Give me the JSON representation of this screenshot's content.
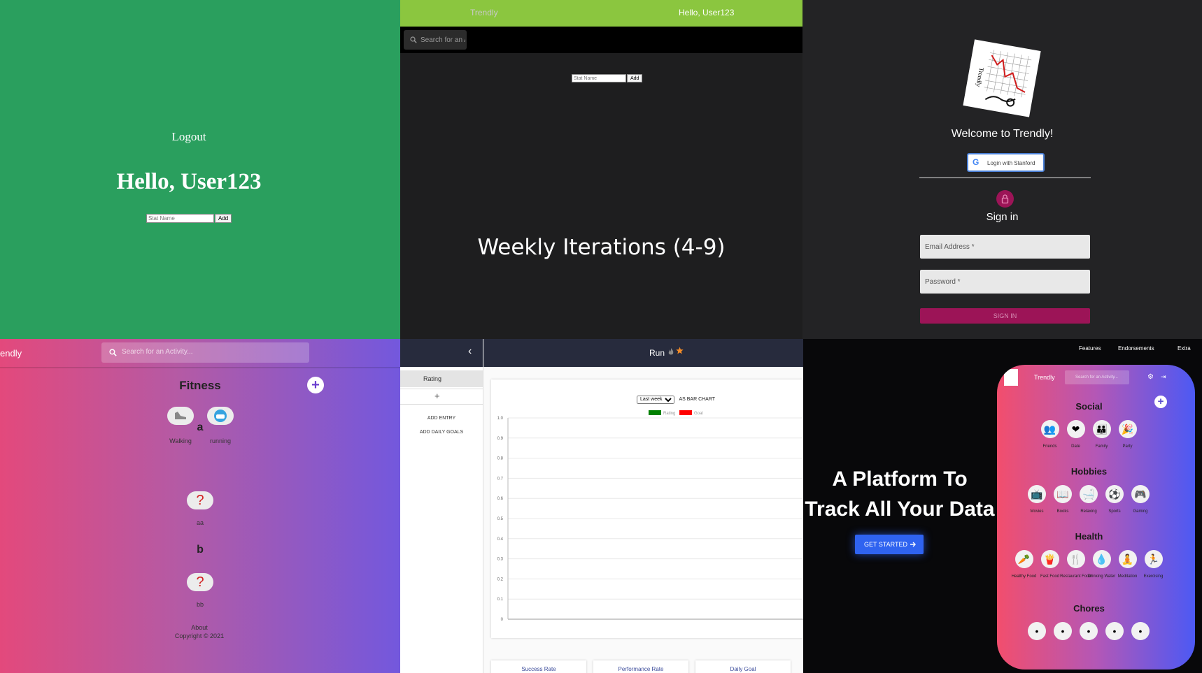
{
  "panel1": {
    "logout": "Logout",
    "greeting": "Hello, User123",
    "stat_placeholder": "Stat Name",
    "add_label": "Add"
  },
  "panel2": {
    "brand": "Trendly",
    "greeting": "Hello, User123",
    "search_placeholder": "Search for an Ac",
    "stat_placeholder": "Stat Name",
    "add_label": "Add",
    "headline": "Weekly Iterations (4-9)"
  },
  "panel3": {
    "logo_text": "Trendly",
    "welcome": "Welcome to Trendly!",
    "google_button": "Login with Stanford",
    "google_glyph": "G",
    "sign_in_title": "Sign in",
    "email_label": "Email Address *",
    "password_label": "Password *",
    "sign_in_button": "SIGN IN",
    "accent": "#9c1457"
  },
  "panel4": {
    "brand": "endly",
    "search_placeholder": "Search for an Activity...",
    "sections": [
      {
        "title": "Fitness",
        "items": [
          {
            "label": "Walking",
            "icon": "shoe-icon"
          },
          {
            "label": "running",
            "icon": "face-icon"
          }
        ]
      },
      {
        "title": "a",
        "items": [
          {
            "label": "aa",
            "icon": "question-icon"
          }
        ]
      },
      {
        "title": "b",
        "items": [
          {
            "label": "bb",
            "icon": "question-icon"
          }
        ]
      }
    ],
    "question_glyph": "?",
    "plus_glyph": "+",
    "about": "About",
    "copyright": "Copyright © 2021"
  },
  "panel5": {
    "back_glyph": "‹",
    "title": "Run",
    "sidebar": {
      "rating": "Rating",
      "plus": "+",
      "add_entry": "ADD ENTRY",
      "add_goals": "ADD DAILY GOALS"
    },
    "range_select": "Last week",
    "view_mode": "AS BAR CHART",
    "cards": [
      "Success Rate",
      "Performance Rate",
      "Daily Goal"
    ]
  },
  "chart_data": {
    "type": "bar",
    "categories": [],
    "series": [
      {
        "name": "Rating",
        "values": [],
        "color": "#008000"
      },
      {
        "name": "Goal",
        "values": [],
        "color": "#ff0000"
      }
    ],
    "ylim": [
      0,
      1.0
    ],
    "yticks": [
      "0",
      "0.1",
      "0.2",
      "0.3",
      "0.4",
      "0.5",
      "0.6",
      "0.7",
      "0.8",
      "0.9",
      "1.0"
    ],
    "legend": "top",
    "grid": true
  },
  "panel6": {
    "nav": [
      "Features",
      "Endorsements",
      "Extra"
    ],
    "headline_1": "A Platform To",
    "headline_2": "Track All Your Data",
    "cta": "GET STARTED",
    "phone": {
      "brand": "Trendly",
      "search_placeholder": "Search for an Activity...",
      "sections": [
        {
          "title": "Social",
          "items": [
            "Friends",
            "Date",
            "Family",
            "Party"
          ]
        },
        {
          "title": "Hobbies",
          "items": [
            "Movies",
            "Books",
            "Relaxing",
            "Sports",
            "Gaming"
          ]
        },
        {
          "title": "Health",
          "items": [
            "Healthy Food",
            "Fast Food",
            "Restaurant Food",
            "Drinking Water",
            "Meditation",
            "Exercising"
          ]
        },
        {
          "title": "Chores",
          "items": [
            "",
            "",
            "",
            "",
            ""
          ]
        }
      ]
    }
  }
}
